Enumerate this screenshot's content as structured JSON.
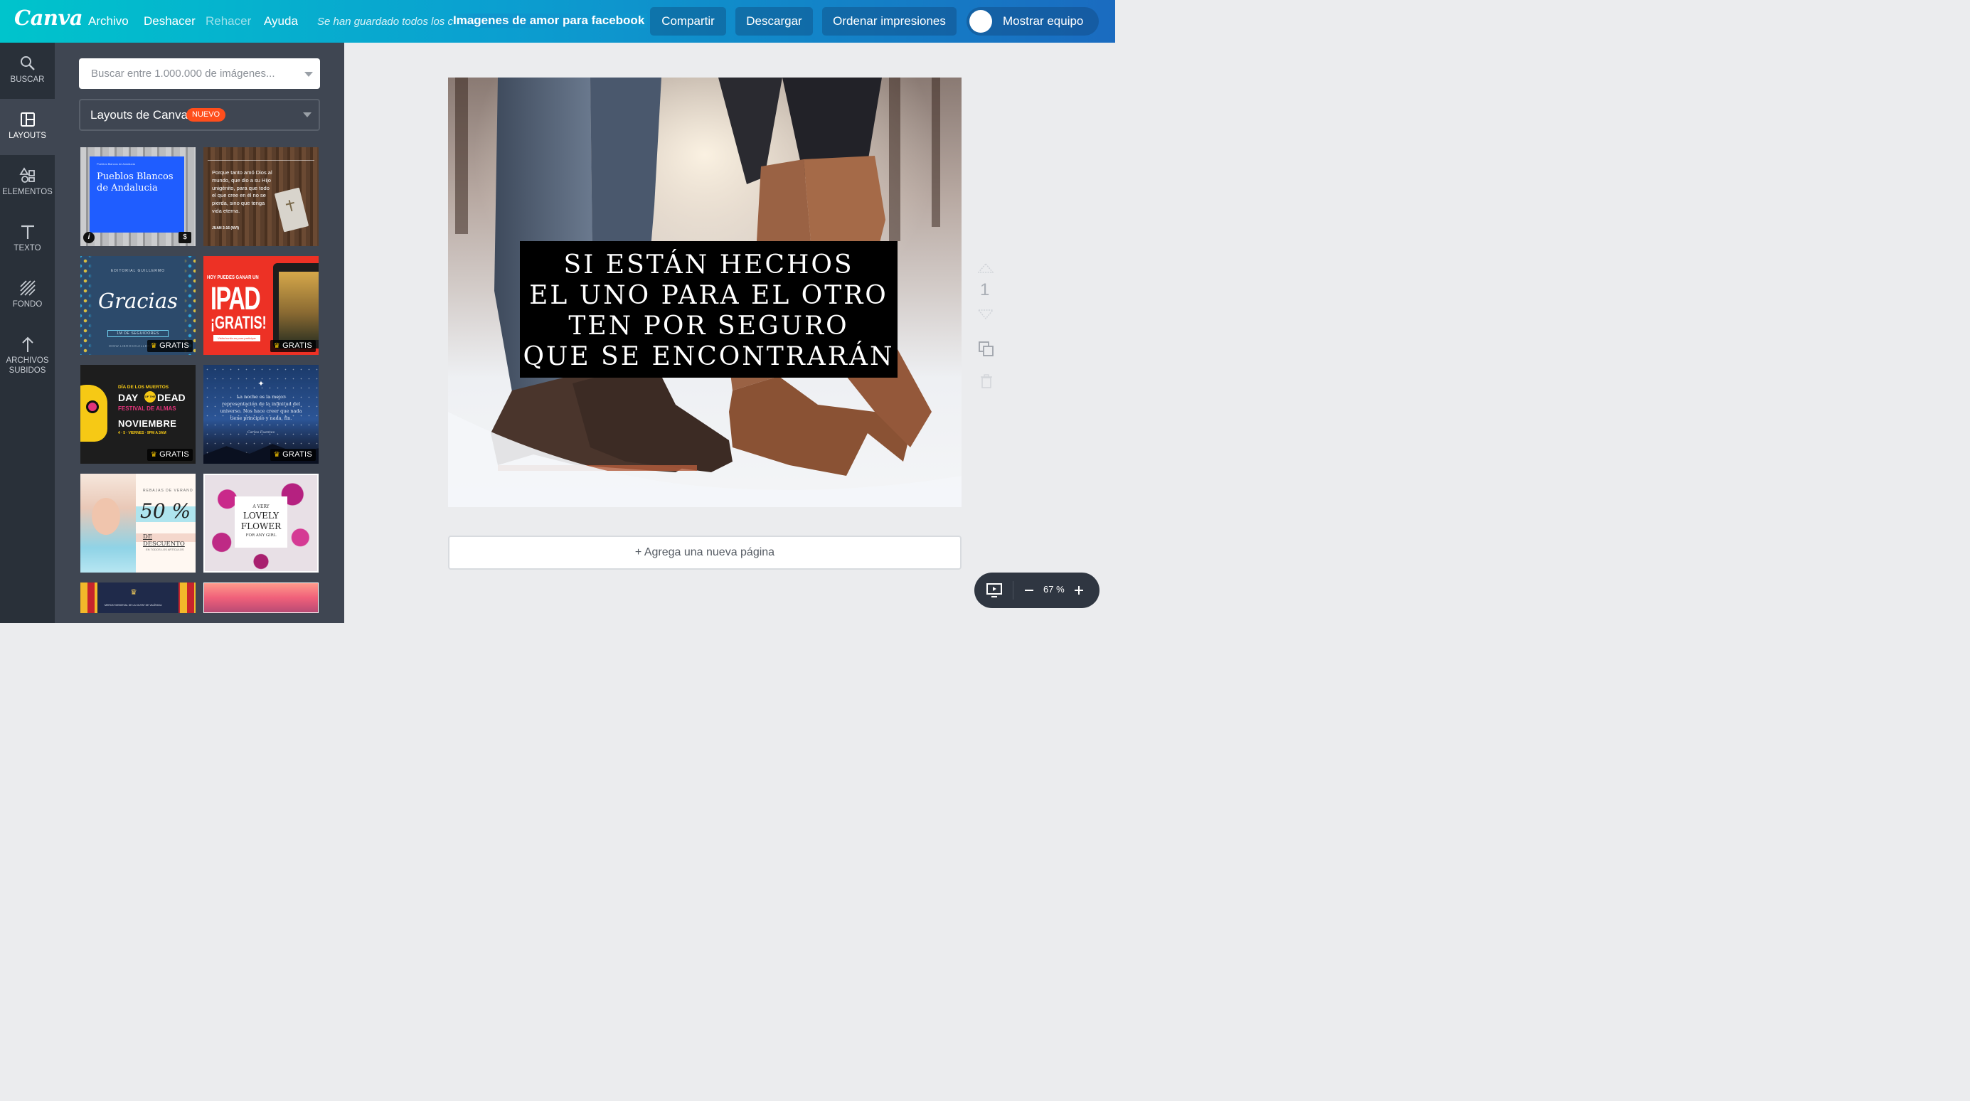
{
  "topbar": {
    "logo": "Canva",
    "menu": [
      "Archivo",
      "Deshacer",
      "Rehacer",
      "Ayuda"
    ],
    "saved_status": "Se han guardado todos los cambios",
    "doc_title": "Imagenes de amor para facebook",
    "buttons": [
      "Compartir",
      "Descargar",
      "Ordenar impresiones"
    ],
    "team_button": "Mostrar equipo"
  },
  "leftnav": {
    "items": [
      {
        "label": "BUSCAR",
        "icon": "search-icon"
      },
      {
        "label": "LAYOUTS",
        "icon": "layouts-icon"
      },
      {
        "label": "ELEMENTOS",
        "icon": "shapes-icon"
      },
      {
        "label": "TEXTO",
        "icon": "text-icon"
      },
      {
        "label": "FONDO",
        "icon": "background-icon"
      },
      {
        "label": "ARCHIVOS\nSUBIDOS",
        "icon": "upload-icon"
      }
    ]
  },
  "panel": {
    "search_placeholder": "Buscar entre 1.000.000 de imágenes...",
    "layout_select": "Layouts de Canva",
    "nuevo_badge": "NUEVO",
    "gratis": "GRATIS",
    "thumbs": {
      "t1": {
        "small": "Pueblos Blancos de Andalucia",
        "title": "Pueblos Blancos de Andalucia",
        "price": "$",
        "info": "i"
      },
      "t2": {
        "quote": "Porque tanto amó Dios al mundo, que dio a su Hijo unigénito, para que todo el que cree en él no se pierda, sino que tenga vida eterna.",
        "ref": "JUAN 3:16 (NVI)"
      },
      "t3": {
        "top": "EDITORIAL  GUILLERMO",
        "title": "Gracias",
        "sub": "1M DE SEGUIDORES",
        "url": "WWW.LIBROSGUILLERMO"
      },
      "t4": {
        "top": "HOY PUEDES GANAR UN",
        "title": "IPAD",
        "title2": "¡GRATIS!",
        "foot": "Visita bonito.es para participar"
      },
      "t5": {
        "l1": "DÍA DE LOS MUERTOS",
        "l2a": "DAY",
        "l2b": "DEAD",
        "l3": "FESTIVAL DE ALMAS",
        "l4": "NOVIEMBRE",
        "l5": "4 · 5 · VIERNES · 9PM A 3AM"
      },
      "t6": {
        "quote": "La noche es la mejor representación de la infinitud del universo. Nos hace creer que nada tiene principio y nada, fin.",
        "author": "Carlos Fuentes"
      },
      "t7": {
        "top": "REBAJAS DE VERANO",
        "big": "50 %",
        "sub": "DE DESCUENTO",
        "foot": "EN TODOS LOS ARTÍCULOS"
      },
      "t8": {
        "l1": "A VERY",
        "l2": "LOVELY",
        "l3": "FLOWER",
        "l4": "FOR ANY GIRL"
      },
      "t9": {
        "text": "MERCAT MEDIEVAL DE LA CIUTAT DE VALÈNCIA"
      }
    }
  },
  "canvas": {
    "quote_lines": [
      "SI ESTÁN HECHOS",
      "EL UNO PARA EL OTRO",
      "TEN POR SEGURO",
      "QUE SE ENCONTRARÁN"
    ],
    "page_number": "1",
    "add_page": "+ Agrega una nueva página",
    "zoom": "67 %"
  }
}
